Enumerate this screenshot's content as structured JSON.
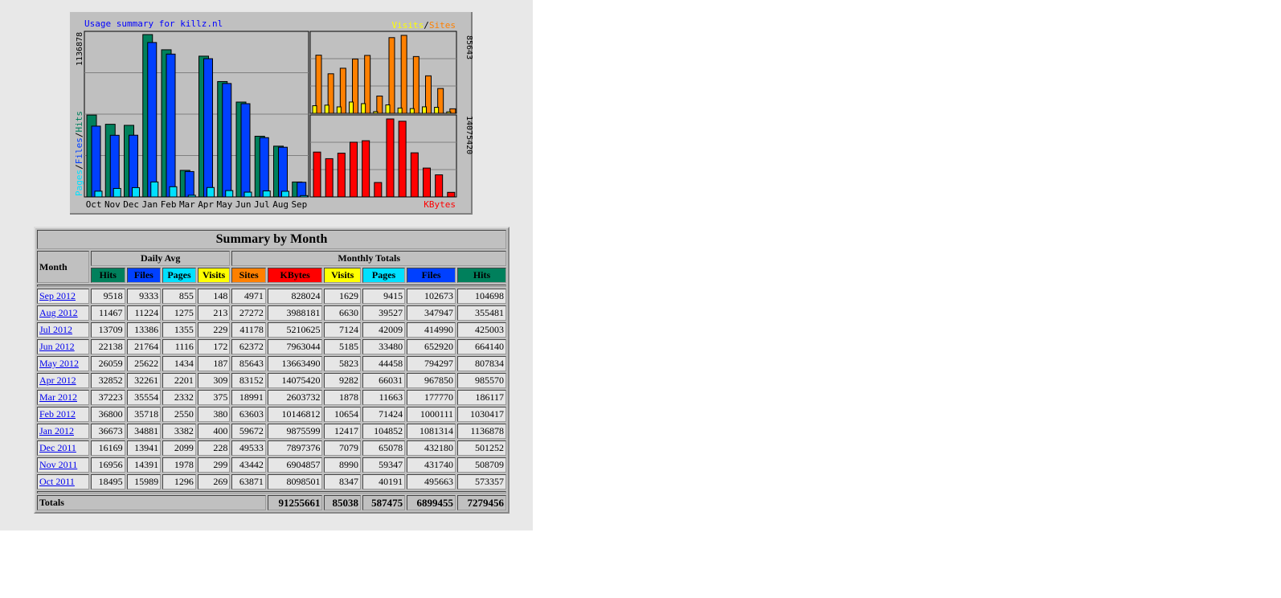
{
  "colors": {
    "hits": "#00805c",
    "files": "#0040ff",
    "pages": "#00e0ff",
    "visits": "#ffff00",
    "sites": "#ff8000",
    "kbytes": "#ff0000",
    "chart_bg": "#c0c0c0",
    "title_blue": "#0000ff"
  },
  "chart_data": {
    "type": "bar",
    "title": "Usage summary for killz.nl",
    "categories": [
      "Oct",
      "Nov",
      "Dec",
      "Jan",
      "Feb",
      "Mar",
      "Apr",
      "May",
      "Jun",
      "Jul",
      "Aug",
      "Sep"
    ],
    "left_panel": {
      "ylabel_parts": [
        "Pages",
        "/",
        "Files",
        "/",
        "Hits"
      ],
      "ymax_label": "1136878",
      "ymax": 1136878,
      "series": [
        {
          "name": "Hits",
          "values": [
            573357,
            508709,
            501252,
            1136878,
            1030417,
            186117,
            985570,
            807834,
            664140,
            425003,
            355481,
            104698
          ]
        },
        {
          "name": "Files",
          "values": [
            495663,
            431740,
            432180,
            1081314,
            1000111,
            177770,
            967850,
            794297,
            652920,
            414990,
            347947,
            102673
          ]
        },
        {
          "name": "Pages",
          "values": [
            40191,
            59347,
            65078,
            104852,
            71424,
            11663,
            66031,
            44458,
            33480,
            42009,
            39527,
            9415
          ]
        }
      ]
    },
    "top_right_panel": {
      "legend": [
        "Visits",
        "/",
        "Sites"
      ],
      "ymax_label": "85643",
      "ymax": 85643,
      "series": [
        {
          "name": "Visits",
          "values": [
            8347,
            8990,
            7079,
            12417,
            10654,
            1878,
            9282,
            5823,
            5185,
            7124,
            6630,
            1629
          ]
        },
        {
          "name": "Sites",
          "values": [
            63871,
            43442,
            49533,
            59672,
            63603,
            18991,
            83152,
            85643,
            62372,
            41178,
            27272,
            4971
          ]
        }
      ]
    },
    "bottom_right_panel": {
      "label": "KBytes",
      "ymax_label": "14075420",
      "ymax": 14075420,
      "series": [
        {
          "name": "KBytes",
          "values": [
            8098501,
            6904857,
            7897376,
            9875599,
            10146812,
            2603732,
            14075420,
            13663490,
            7963044,
            5210625,
            3988181,
            828024
          ]
        }
      ]
    }
  },
  "table": {
    "title": "Summary by Month",
    "month_header": "Month",
    "daily_avg_header": "Daily Avg",
    "monthly_totals_header": "Monthly Totals",
    "daily_cols": [
      "Hits",
      "Files",
      "Pages",
      "Visits"
    ],
    "monthly_cols": [
      "Sites",
      "KBytes",
      "Visits",
      "Pages",
      "Files",
      "Hits"
    ],
    "rows": [
      {
        "month": "Sep 2012",
        "d_hits": "9518",
        "d_files": "9333",
        "d_pages": "855",
        "d_visits": "148",
        "sites": "4971",
        "kbytes": "828024",
        "visits": "1629",
        "pages": "9415",
        "files": "102673",
        "hits": "104698"
      },
      {
        "month": "Aug 2012",
        "d_hits": "11467",
        "d_files": "11224",
        "d_pages": "1275",
        "d_visits": "213",
        "sites": "27272",
        "kbytes": "3988181",
        "visits": "6630",
        "pages": "39527",
        "files": "347947",
        "hits": "355481"
      },
      {
        "month": "Jul 2012",
        "d_hits": "13709",
        "d_files": "13386",
        "d_pages": "1355",
        "d_visits": "229",
        "sites": "41178",
        "kbytes": "5210625",
        "visits": "7124",
        "pages": "42009",
        "files": "414990",
        "hits": "425003"
      },
      {
        "month": "Jun 2012",
        "d_hits": "22138",
        "d_files": "21764",
        "d_pages": "1116",
        "d_visits": "172",
        "sites": "62372",
        "kbytes": "7963044",
        "visits": "5185",
        "pages": "33480",
        "files": "652920",
        "hits": "664140"
      },
      {
        "month": "May 2012",
        "d_hits": "26059",
        "d_files": "25622",
        "d_pages": "1434",
        "d_visits": "187",
        "sites": "85643",
        "kbytes": "13663490",
        "visits": "5823",
        "pages": "44458",
        "files": "794297",
        "hits": "807834"
      },
      {
        "month": "Apr 2012",
        "d_hits": "32852",
        "d_files": "32261",
        "d_pages": "2201",
        "d_visits": "309",
        "sites": "83152",
        "kbytes": "14075420",
        "visits": "9282",
        "pages": "66031",
        "files": "967850",
        "hits": "985570"
      },
      {
        "month": "Mar 2012",
        "d_hits": "37223",
        "d_files": "35554",
        "d_pages": "2332",
        "d_visits": "375",
        "sites": "18991",
        "kbytes": "2603732",
        "visits": "1878",
        "pages": "11663",
        "files": "177770",
        "hits": "186117"
      },
      {
        "month": "Feb 2012",
        "d_hits": "36800",
        "d_files": "35718",
        "d_pages": "2550",
        "d_visits": "380",
        "sites": "63603",
        "kbytes": "10146812",
        "visits": "10654",
        "pages": "71424",
        "files": "1000111",
        "hits": "1030417"
      },
      {
        "month": "Jan 2012",
        "d_hits": "36673",
        "d_files": "34881",
        "d_pages": "3382",
        "d_visits": "400",
        "sites": "59672",
        "kbytes": "9875599",
        "visits": "12417",
        "pages": "104852",
        "files": "1081314",
        "hits": "1136878"
      },
      {
        "month": "Dec 2011",
        "d_hits": "16169",
        "d_files": "13941",
        "d_pages": "2099",
        "d_visits": "228",
        "sites": "49533",
        "kbytes": "7897376",
        "visits": "7079",
        "pages": "65078",
        "files": "432180",
        "hits": "501252"
      },
      {
        "month": "Nov 2011",
        "d_hits": "16956",
        "d_files": "14391",
        "d_pages": "1978",
        "d_visits": "299",
        "sites": "43442",
        "kbytes": "6904857",
        "visits": "8990",
        "pages": "59347",
        "files": "431740",
        "hits": "508709"
      },
      {
        "month": "Oct 2011",
        "d_hits": "18495",
        "d_files": "15989",
        "d_pages": "1296",
        "d_visits": "269",
        "sites": "63871",
        "kbytes": "8098501",
        "visits": "8347",
        "pages": "40191",
        "files": "495663",
        "hits": "573357"
      }
    ],
    "totals": {
      "label": "Totals",
      "kbytes": "91255661",
      "visits": "85038",
      "pages": "587475",
      "files": "6899455",
      "hits": "7279456"
    }
  }
}
